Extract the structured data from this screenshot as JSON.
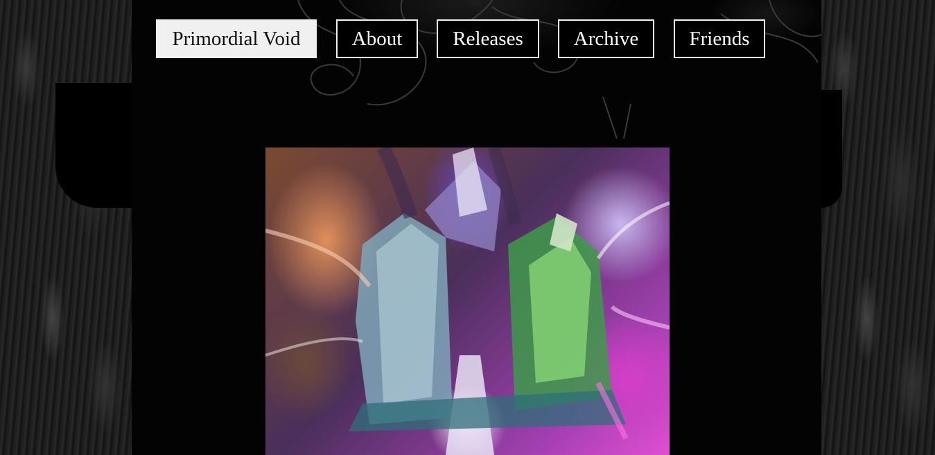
{
  "nav": {
    "items": [
      {
        "label": "Primordial Void",
        "active": true
      },
      {
        "label": "About",
        "active": false
      },
      {
        "label": "Releases",
        "active": false
      },
      {
        "label": "Archive",
        "active": false
      },
      {
        "label": "Friends",
        "active": false
      }
    ]
  },
  "colors": {
    "background": "#000000",
    "nav_border": "#f2f2f2",
    "nav_active_bg": "#f0f0f0",
    "nav_text": "#ffffff"
  }
}
